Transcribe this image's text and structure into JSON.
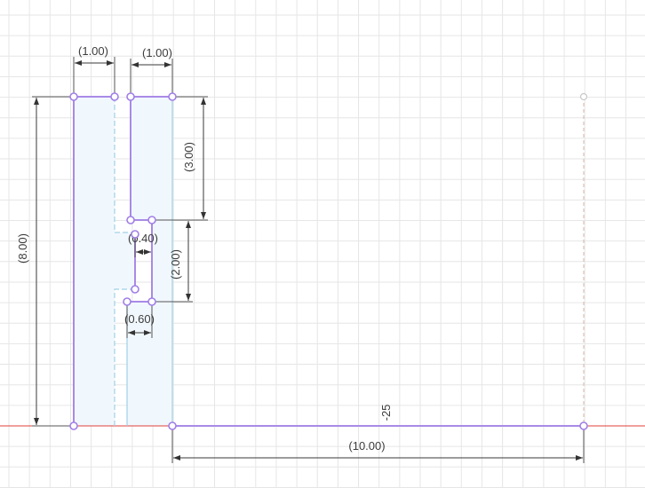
{
  "canvas": {
    "background_color": "#ffffff",
    "grid_color": "#e6e6e6",
    "profile_color": "#a98ae6",
    "construction_color": "#9fd0e6",
    "fill_color": "#f1f8fd",
    "x_axis_color": "#e0413a"
  },
  "dimensions": {
    "width_left": "(1.00)",
    "width_right": "(1.00)",
    "height_total": "(8.00)",
    "height_upper": "(3.00)",
    "height_slot": "(2.00)",
    "slot_width_top": "(0.40)",
    "slot_width_bottom": "(0.60)",
    "base_length": "(10.00)",
    "angle_value": "-25"
  }
}
